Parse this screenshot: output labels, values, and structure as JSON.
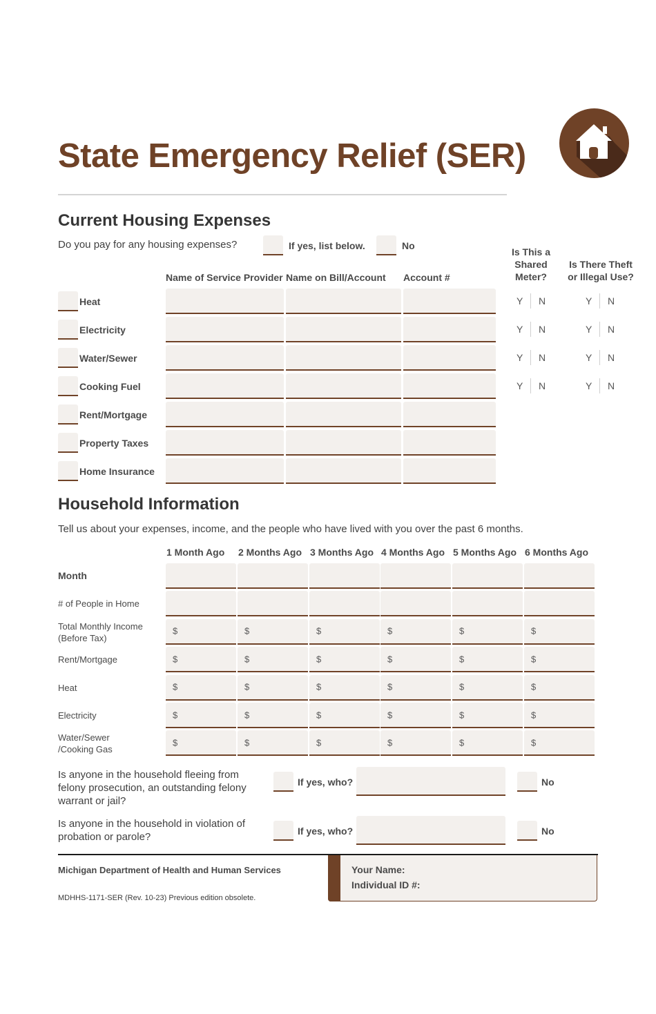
{
  "header": {
    "title": "State Emergency Relief (SER)",
    "logo_icon": "house-icon",
    "brand_color": "#6f4227"
  },
  "housing": {
    "heading": "Current Housing Expenses",
    "question": "Do you pay for any housing expenses?",
    "yes_label": "If yes, list below.",
    "no_label": "No",
    "columns": [
      "Name of Service Provider",
      "Name on Bill/Account",
      "Account #"
    ],
    "shared_meter_header": [
      "Is This a",
      "Shared",
      "Meter?"
    ],
    "theft_header": [
      "Is There Theft",
      "or Illegal Use?"
    ],
    "yes_letter": "Y",
    "no_letter": "N",
    "rows": [
      {
        "label": "Heat",
        "has_yn": true
      },
      {
        "label": "Electricity",
        "has_yn": true
      },
      {
        "label": "Water/Sewer",
        "has_yn": true
      },
      {
        "label": "Cooking Fuel",
        "has_yn": true
      },
      {
        "label": "Rent/Mortgage",
        "has_yn": false
      },
      {
        "label": "Property Taxes",
        "has_yn": false
      },
      {
        "label": "Home Insurance",
        "has_yn": false
      }
    ]
  },
  "household": {
    "heading": "Household Information",
    "intro": "Tell us about your expenses, income, and the people who have lived with you over the past 6 months.",
    "columns": [
      "1 Month Ago",
      "2 Months Ago",
      "3 Months Ago",
      "4 Months Ago",
      "5 Months Ago",
      "6 Months Ago"
    ],
    "currency_symbol": "$",
    "rows": [
      {
        "label": [
          "Month"
        ],
        "bold": true,
        "currency": false
      },
      {
        "label": [
          "# of People in Home"
        ],
        "bold": false,
        "currency": false
      },
      {
        "label": [
          "Total Monthly Income",
          "(Before Tax)"
        ],
        "bold": false,
        "currency": true
      },
      {
        "label": [
          "Rent/Mortgage"
        ],
        "bold": false,
        "currency": true
      },
      {
        "label": [
          "Heat"
        ],
        "bold": false,
        "currency": true
      },
      {
        "label": [
          "Electricity"
        ],
        "bold": false,
        "currency": true
      },
      {
        "label": [
          "Water/Sewer",
          "/Cooking Gas"
        ],
        "bold": false,
        "currency": true
      }
    ],
    "questions": [
      {
        "text": [
          "Is anyone in the household fleeing from",
          "felony prosecution, an outstanding felony",
          "warrant or jail?"
        ],
        "yes_label": "If yes, who?",
        "no_label": "No"
      },
      {
        "text": [
          "Is anyone in the household in violation of",
          "probation or parole?"
        ],
        "yes_label": "If yes, who?",
        "no_label": "No"
      }
    ]
  },
  "footer": {
    "department": "Michigan Department of Health and Human Services",
    "form_id": "MDHHS-1171-SER (Rev. 10-23) Previous edition obsolete.",
    "your_name_label": "Your Name:",
    "individual_id_label": "Individual ID #:"
  }
}
